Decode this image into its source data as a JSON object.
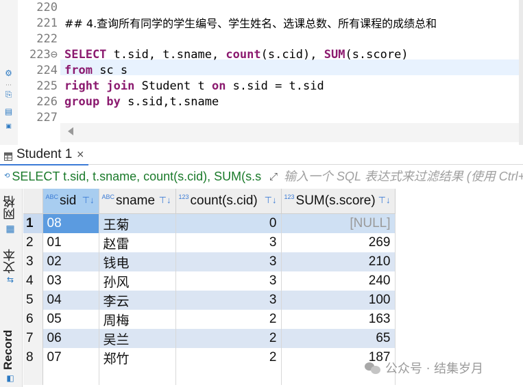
{
  "editor": {
    "lines": [
      {
        "num": "220",
        "segments": []
      },
      {
        "num": "221",
        "segments": [
          {
            "t": "## 4.查询所有同学的学生编号、学生姓名、选课总数、所有课程的成绩总和",
            "k": false
          }
        ]
      },
      {
        "num": "222",
        "segments": []
      },
      {
        "num": "223⊖",
        "segments": [
          {
            "t": "SELECT",
            "k": true
          },
          {
            "t": " t.sid, t.sname, ",
            "k": false
          },
          {
            "t": "count",
            "k": true
          },
          {
            "t": "(s.cid), ",
            "k": false
          },
          {
            "t": "SUM",
            "k": true
          },
          {
            "t": "(s.score)",
            "k": false
          }
        ]
      },
      {
        "num": "224",
        "segments": [
          {
            "t": "from",
            "k": true
          },
          {
            "t": " sc s",
            "k": false
          }
        ]
      },
      {
        "num": "225",
        "segments": [
          {
            "t": "right join",
            "k": true
          },
          {
            "t": " Student t ",
            "k": false
          },
          {
            "t": "on",
            "k": true
          },
          {
            "t": " s.sid = t.sid",
            "k": false
          }
        ]
      },
      {
        "num": "226",
        "segments": [
          {
            "t": "group by",
            "k": true
          },
          {
            "t": " s.sid,t.sname",
            "k": false
          }
        ]
      },
      {
        "num": "227",
        "segments": []
      }
    ],
    "gutter_icons": [
      "gear-icon",
      "dots-icon",
      "export-icon",
      "error-file-icon",
      "sql-file-icon"
    ]
  },
  "tab": {
    "label": "Student 1",
    "close": "×"
  },
  "filter": {
    "sql": "SELECT t.sid, t.sname, count(s.cid), SUM(s.score) from sc s right join Student t on s.sid = t.sid group by s.sid,t.sname",
    "placeholder": "输入一个 SQL 表达式来过滤结果 (使用 Ctrl+空格)"
  },
  "side": {
    "grid_label": "网格",
    "text_label": "文本",
    "record_label": "Record"
  },
  "grid": {
    "columns": [
      {
        "name": "sid",
        "type": "ABC",
        "align": "left"
      },
      {
        "name": "sname",
        "type": "ABC",
        "align": "left"
      },
      {
        "name": "count(s.cid)",
        "type": "123",
        "align": "right"
      },
      {
        "name": "SUM(s.score)",
        "type": "123",
        "align": "right"
      }
    ],
    "rows": [
      {
        "n": "1",
        "sid": "08",
        "sname": "王菊",
        "count": "0",
        "sum": "[NULL]"
      },
      {
        "n": "2",
        "sid": "01",
        "sname": "赵雷",
        "count": "3",
        "sum": "269"
      },
      {
        "n": "3",
        "sid": "02",
        "sname": "钱电",
        "count": "3",
        "sum": "210"
      },
      {
        "n": "4",
        "sid": "03",
        "sname": "孙风",
        "count": "3",
        "sum": "240"
      },
      {
        "n": "5",
        "sid": "04",
        "sname": "李云",
        "count": "3",
        "sum": "100"
      },
      {
        "n": "6",
        "sid": "05",
        "sname": "周梅",
        "count": "2",
        "sum": "163"
      },
      {
        "n": "7",
        "sid": "06",
        "sname": "吴兰",
        "count": "2",
        "sum": "65"
      },
      {
        "n": "8",
        "sid": "07",
        "sname": "郑竹",
        "count": "2",
        "sum": "187"
      }
    ]
  },
  "watermark": {
    "text": "公众号 · 结集岁月"
  },
  "colors": {
    "keyword": "#8b1a6f",
    "selection": "#5b9be0",
    "alt_row": "#dbe5f3",
    "accent": "#2b79c2",
    "sql_text": "#1a7a2a"
  }
}
